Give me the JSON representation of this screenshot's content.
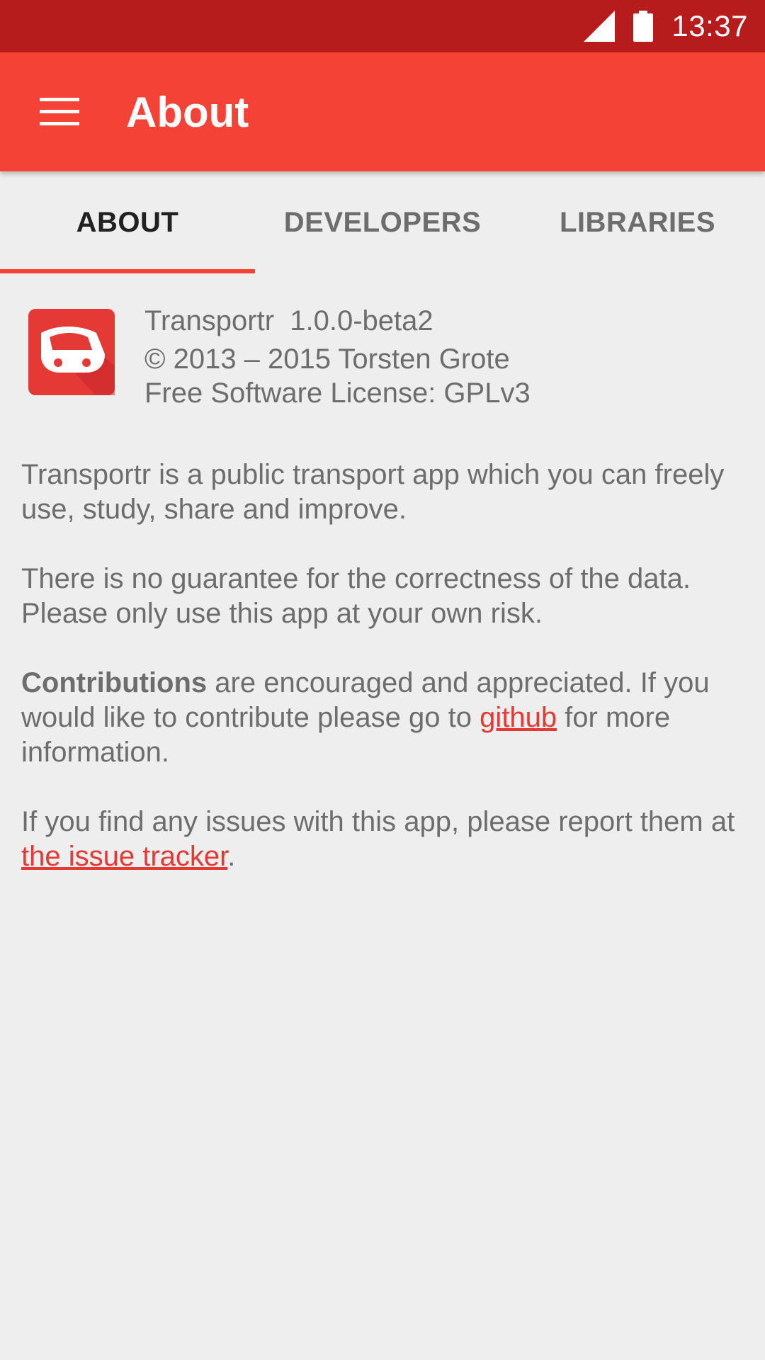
{
  "status_bar": {
    "time": "13:37",
    "icons": [
      "cell-signal-icon",
      "battery-icon"
    ]
  },
  "toolbar": {
    "menu_icon": "hamburger-menu-icon",
    "title": "About"
  },
  "tabs": [
    {
      "label": "ABOUT",
      "active": true
    },
    {
      "label": "DEVELOPERS",
      "active": false
    },
    {
      "label": "LIBRARIES",
      "active": false
    }
  ],
  "app": {
    "logo_icon": "transportr-train-logo",
    "name_version": "Transportr  1.0.0-beta2",
    "copyright": "© 2013 – 2015 Torsten Grote",
    "license": "Free Software License: GPLv3"
  },
  "paragraphs": {
    "p1": "Transportr is a public transport app which you can freely use, study, share and improve.",
    "p2": "There is no guarantee for the correctness of the data. Please only use this app at your own risk.",
    "p3_bold": "Contributions",
    "p3_text_a": " are encouraged and appreciated. If you would like to contribute please go to ",
    "p3_link": "github",
    "p3_text_b": " for more information.",
    "p4_text_a": "If you find any issues with this app, please report them at ",
    "p4_link": "the issue tracker",
    "p4_text_b": "."
  },
  "colors": {
    "status_bar": "#b71c1c",
    "toolbar": "#f44336",
    "background": "#eeeeee",
    "text": "#6d6d6d",
    "link": "#e53935"
  }
}
